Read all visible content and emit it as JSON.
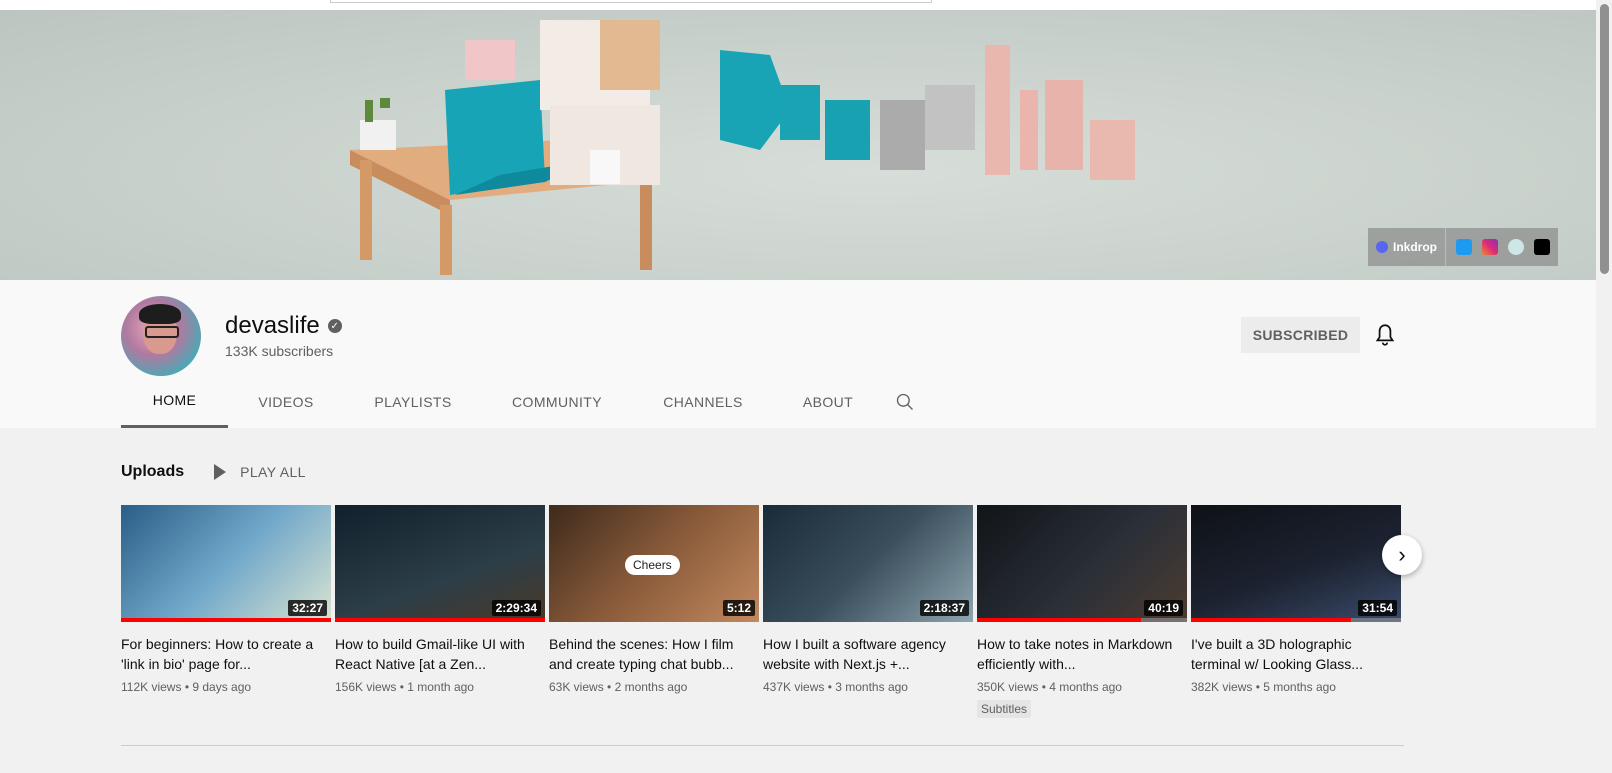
{
  "banner": {
    "links": {
      "inkdrop_label": "Inkdrop",
      "social_icons": [
        "twitter-icon",
        "instagram-icon",
        "circle-avatar-icon",
        "medium-icon"
      ]
    },
    "colors": {
      "teal": "#1aa3b3",
      "pink": "#e8b3ab",
      "grey": "#a9a9a9"
    }
  },
  "channel": {
    "name": "devaslife",
    "subscribers": "133K subscribers",
    "subscribe_label": "SUBSCRIBED"
  },
  "tabs": [
    "HOME",
    "VIDEOS",
    "PLAYLISTS",
    "COMMUNITY",
    "CHANNELS",
    "ABOUT"
  ],
  "uploads": {
    "title": "Uploads",
    "play_all": "PLAY ALL",
    "videos": [
      {
        "title": "For beginners: How to create a 'link in bio' page for...",
        "duration": "32:27",
        "views": "112K views",
        "age": "9 days ago",
        "watched": 1.0,
        "badge": ""
      },
      {
        "title": "How to build Gmail-like UI with React Native [at a Zen...",
        "duration": "2:29:34",
        "views": "156K views",
        "age": "1 month ago",
        "watched": 1.0,
        "badge": ""
      },
      {
        "title": "Behind the scenes: How I film and create typing chat bubb...",
        "duration": "5:12",
        "views": "63K views",
        "age": "2 months ago",
        "watched": 0,
        "badge": "",
        "bubble": "Cheers"
      },
      {
        "title": "How I built a software agency website with Next.js +...",
        "duration": "2:18:37",
        "views": "437K views",
        "age": "3 months ago",
        "watched": 0,
        "badge": ""
      },
      {
        "title": "How to take notes in Markdown efficiently with...",
        "duration": "40:19",
        "views": "350K views",
        "age": "4 months ago",
        "watched": 0.78,
        "badge": "Subtitles"
      },
      {
        "title": "I've built a 3D holographic terminal w/ Looking Glass...",
        "duration": "31:54",
        "views": "382K views",
        "age": "5 months ago",
        "watched": 0.76,
        "badge": ""
      }
    ]
  }
}
